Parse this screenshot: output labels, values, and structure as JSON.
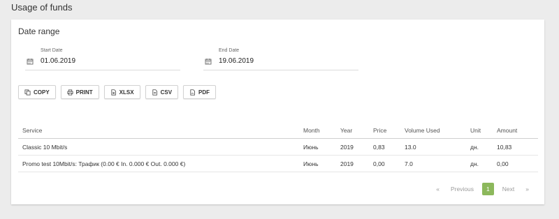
{
  "page": {
    "title": "Usage of funds"
  },
  "filter": {
    "title": "Date range",
    "start": {
      "label": "Start Date",
      "value": "01.06.2019"
    },
    "end": {
      "label": "End Date",
      "value": "19.06.2019"
    }
  },
  "export": {
    "buttons": [
      {
        "label": "COPY",
        "icon": "copy-icon"
      },
      {
        "label": "PRINT",
        "icon": "print-icon"
      },
      {
        "label": "XLSX",
        "icon": "file-icon"
      },
      {
        "label": "CSV",
        "icon": "file-icon"
      },
      {
        "label": "PDF",
        "icon": "file-icon"
      }
    ]
  },
  "table": {
    "headers": [
      "Service",
      "Month",
      "Year",
      "Price",
      "Volume Used",
      "Unit",
      "Amount"
    ],
    "rows": [
      [
        "Classic 10 Mbit/s",
        "Июнь",
        "2019",
        "0,83",
        "13.0",
        "дн.",
        "10,83"
      ],
      [
        "Promo test 10Mbit/s: Трафик (0.00 € In. 0.000 € Out. 0.000 €)",
        "Июнь",
        "2019",
        "0,00",
        "7.0",
        "дн.",
        "0,00"
      ]
    ]
  },
  "pagination": {
    "first": "«",
    "previous": "Previous",
    "current": "1",
    "next": "Next",
    "last": "»"
  }
}
